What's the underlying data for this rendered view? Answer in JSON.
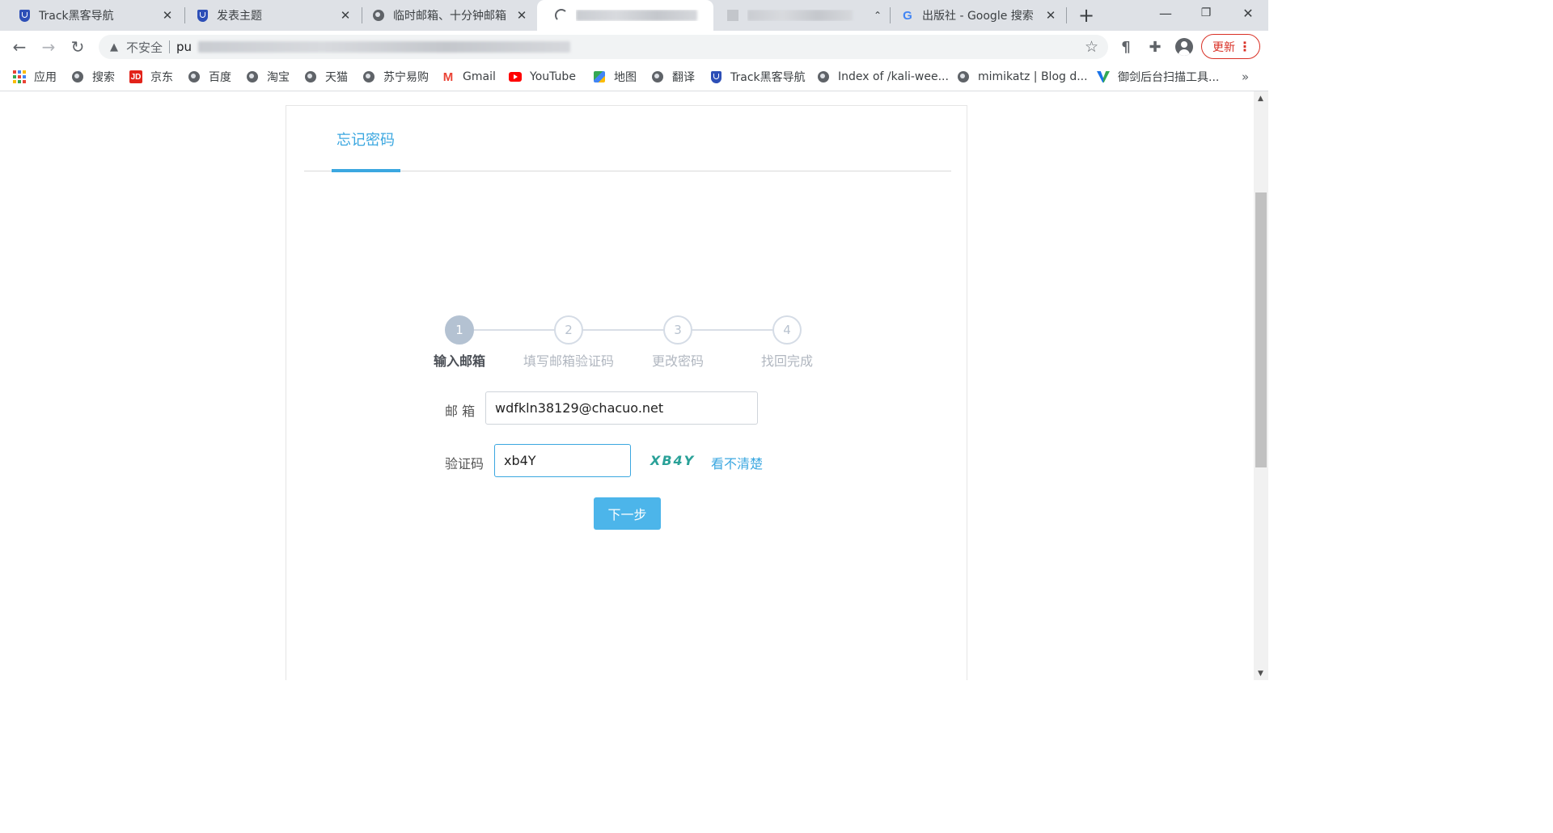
{
  "browser": {
    "tabs": [
      {
        "label": "Track黑客导航",
        "icon": "shield-icon"
      },
      {
        "label": "发表主题",
        "icon": "shield-icon"
      },
      {
        "label": "临时邮箱、十分钟邮箱",
        "icon": "globe-icon"
      },
      {
        "label": "",
        "icon": "loading-icon"
      },
      {
        "label": "",
        "icon": "globe-icon"
      },
      {
        "label": "出版社 - Google 搜索",
        "icon": "google-icon"
      }
    ],
    "new_tab": "+",
    "window_controls": {
      "minimize": "—",
      "restore": "❐",
      "close": "✕"
    },
    "address": {
      "security": "不安全",
      "url": "pu"
    },
    "update_label": "更新"
  },
  "bookmarks": [
    {
      "label": "应用",
      "icon": "apps-grid-icon"
    },
    {
      "label": "搜索",
      "icon": "globe-icon"
    },
    {
      "label": "京东",
      "icon": "jd-icon"
    },
    {
      "label": "百度",
      "icon": "globe-icon"
    },
    {
      "label": "淘宝",
      "icon": "globe-icon"
    },
    {
      "label": "天猫",
      "icon": "globe-icon"
    },
    {
      "label": "苏宁易购",
      "icon": "globe-icon"
    },
    {
      "label": "Gmail",
      "icon": "gmail-icon"
    },
    {
      "label": "YouTube",
      "icon": "youtube-icon"
    },
    {
      "label": "地图",
      "icon": "maps-icon"
    },
    {
      "label": "翻译",
      "icon": "globe-icon"
    },
    {
      "label": "Track黑客导航",
      "icon": "shield-icon"
    },
    {
      "label": "Index of /kali-wee...",
      "icon": "globe-icon"
    },
    {
      "label": "mimikatz | Blog d...",
      "icon": "globe-icon"
    },
    {
      "label": "御剑后台扫描工具...",
      "icon": "yujian-icon"
    }
  ],
  "bookmarks_more": "»",
  "page": {
    "title": "忘记密码",
    "steps": [
      {
        "number": "1",
        "label": "输入邮箱",
        "active": true
      },
      {
        "number": "2",
        "label": "填写邮箱验证码",
        "active": false
      },
      {
        "number": "3",
        "label": "更改密码",
        "active": false
      },
      {
        "number": "4",
        "label": "找回完成",
        "active": false
      }
    ],
    "form": {
      "email_label": "邮 箱",
      "email_value": "wdfkln38129@chacuo.net",
      "captcha_label": "验证码",
      "captcha_value": "xb4Y",
      "captcha_image_text": "XB4Y",
      "captcha_refresh": "看不清楚",
      "submit": "下一步"
    }
  },
  "colors": {
    "accent": "#3ba7e0",
    "button": "#4cb5ea",
    "captcha": "#2aa198",
    "update": "#d93025"
  }
}
